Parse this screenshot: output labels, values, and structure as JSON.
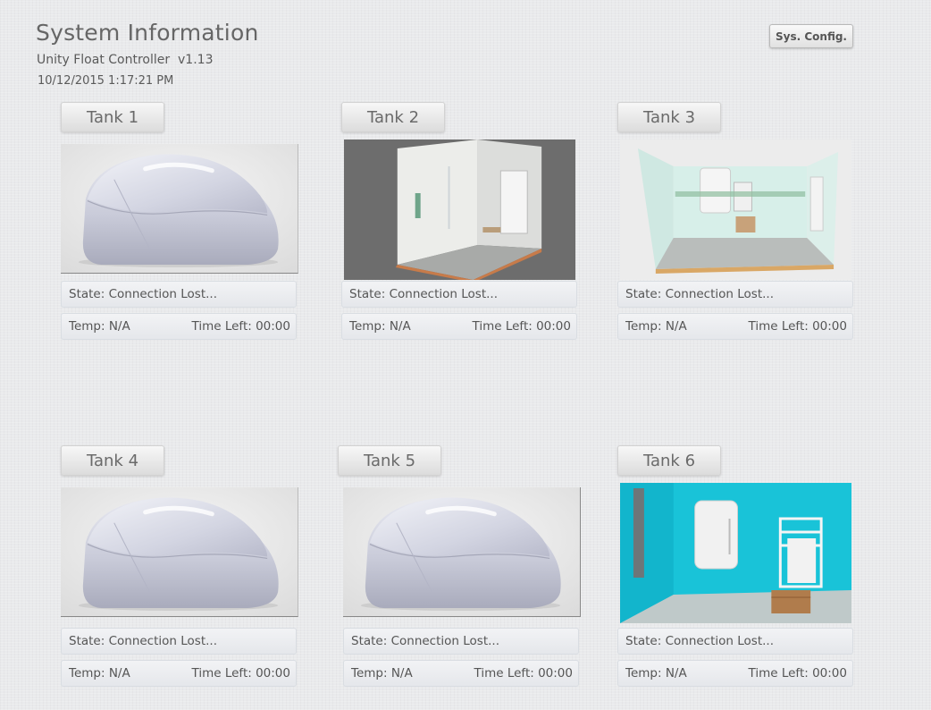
{
  "header": {
    "title": "System Information",
    "subtitle": "Unity Float Controller  v1.13",
    "datetime": "10/12/2015 1:17:21 PM",
    "config_button": "Sys. Config."
  },
  "tanks": [
    {
      "name": "Tank 1",
      "image": "float-pod",
      "state": "State: Connection Lost...",
      "temp": "Temp: N/A",
      "time_left": "Time Left: 00:00"
    },
    {
      "name": "Tank 2",
      "image": "float-room-gray",
      "state": "State: Connection Lost...",
      "temp": "Temp: N/A",
      "time_left": "Time Left: 00:00"
    },
    {
      "name": "Tank 3",
      "image": "float-room-white",
      "state": "State: Connection Lost...",
      "temp": "Temp: N/A",
      "time_left": "Time Left: 00:00"
    },
    {
      "name": "Tank 4",
      "image": "float-pod",
      "state": "State: Connection Lost...",
      "temp": "Temp: N/A",
      "time_left": "Time Left: 00:00"
    },
    {
      "name": "Tank 5",
      "image": "float-pod",
      "state": "State: Connection Lost...",
      "temp": "Temp: N/A",
      "time_left": "Time Left: 00:00"
    },
    {
      "name": "Tank 6",
      "image": "float-room-cyan",
      "state": "State: Connection Lost...",
      "temp": "Temp: N/A",
      "time_left": "Time Left: 00:00"
    }
  ]
}
